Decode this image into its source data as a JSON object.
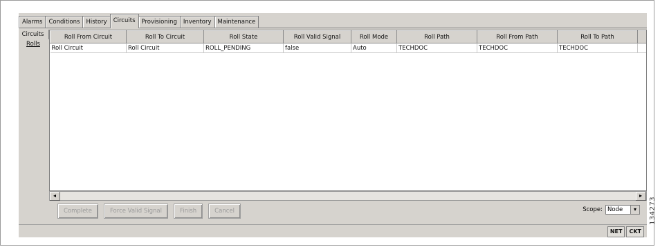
{
  "tabs": [
    {
      "label": "Alarms"
    },
    {
      "label": "Conditions"
    },
    {
      "label": "History"
    },
    {
      "label": "Circuits",
      "active": true
    },
    {
      "label": "Provisioning"
    },
    {
      "label": "Inventory"
    },
    {
      "label": "Maintenance"
    }
  ],
  "subnav": [
    {
      "label": "Circuits"
    },
    {
      "label": "Rolls",
      "active": true
    }
  ],
  "table": {
    "columns": [
      "Roll From Circuit",
      "Roll To Circuit",
      "Roll State",
      "Roll Valid Signal",
      "Roll Mode",
      "Roll Path",
      "Roll From Path",
      "Roll To Path"
    ],
    "rows": [
      [
        "Roll Circuit",
        "Roll Circuit",
        "ROLL_PENDING",
        "false",
        "Auto",
        "TECHDOC",
        "TECHDOC",
        "TECHDOC"
      ]
    ]
  },
  "scrollbar": {
    "left_arrow": "◂",
    "right_arrow": "▸"
  },
  "buttons": {
    "complete": "Complete",
    "force_valid_signal": "Force Valid Signal",
    "finish": "Finish",
    "cancel": "Cancel"
  },
  "scope": {
    "label": "Scope:",
    "value": "Node",
    "arrow": "▾"
  },
  "status": {
    "net": "NET",
    "ckt": "CKT"
  },
  "figure_number": "134273"
}
